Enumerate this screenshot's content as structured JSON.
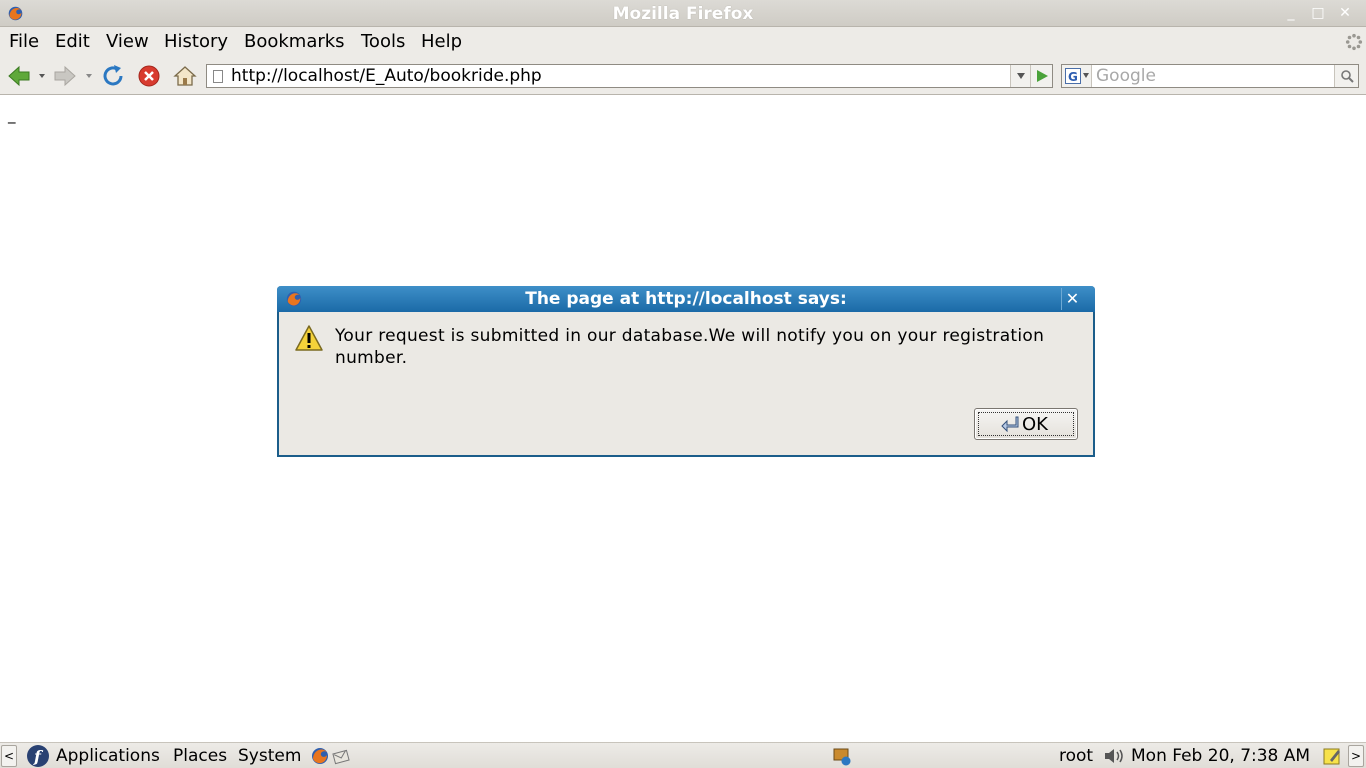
{
  "window": {
    "title": "Mozilla Firefox",
    "controls": {
      "minimize": "_",
      "maximize": "□",
      "close": "✕"
    }
  },
  "menubar": {
    "items": [
      "File",
      "Edit",
      "View",
      "History",
      "Bookmarks",
      "Tools",
      "Help"
    ]
  },
  "toolbar": {
    "url": "http://localhost/E_Auto/bookride.php",
    "search_placeholder": "Google"
  },
  "content": {
    "cursor_text": "_"
  },
  "dialog": {
    "title": "The page at http://localhost says:",
    "close_label": "✕",
    "message": "Your request is submitted in our database.We will notify you on your registration number.",
    "ok_label": "OK"
  },
  "panel": {
    "applications_label": "Applications",
    "places_label": "Places",
    "system_label": "System",
    "user": "root",
    "datetime": "Mon Feb 20,  7:38 AM",
    "left_arrow": "<",
    "right_arrow": ">"
  },
  "colors": {
    "dialog_title": "#1b6aa7",
    "chrome_bg": "#edebe7"
  }
}
